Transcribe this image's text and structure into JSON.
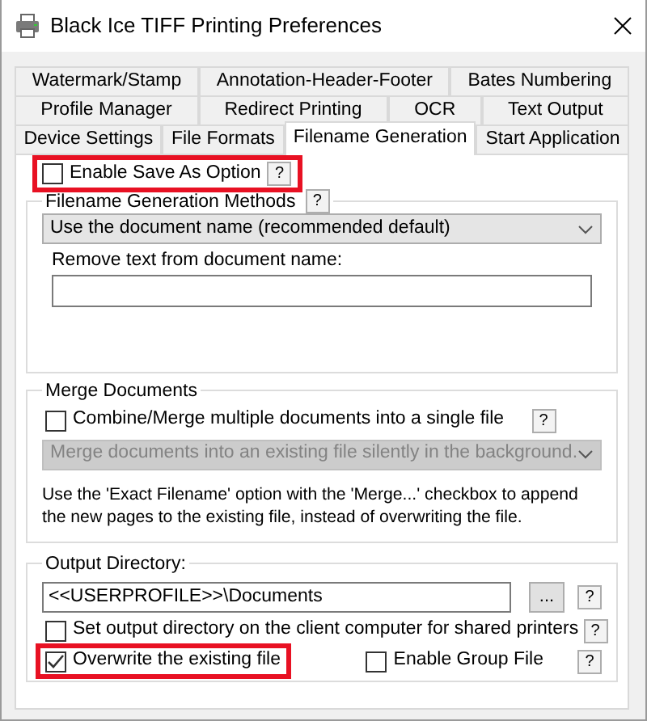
{
  "window": {
    "title": "Black Ice TIFF Printing Preferences"
  },
  "tab_rows": [
    {
      "tabs": [
        {
          "label": "Watermark/Stamp",
          "selected": false
        },
        {
          "label": "Annotation-Header-Footer",
          "selected": false
        },
        {
          "label": "Bates Numbering",
          "selected": false
        }
      ]
    },
    {
      "tabs": [
        {
          "label": "Profile Manager",
          "selected": false
        },
        {
          "label": "Redirect Printing",
          "selected": false
        },
        {
          "label": "OCR",
          "selected": false
        },
        {
          "label": "Text Output",
          "selected": false
        }
      ]
    },
    {
      "tabs": [
        {
          "label": "Device Settings",
          "selected": false
        },
        {
          "label": "File Formats",
          "selected": false
        },
        {
          "label": "Filename Generation",
          "selected": true
        },
        {
          "label": "Start Application",
          "selected": false
        }
      ]
    }
  ],
  "save_as": {
    "label": "Enable Save As Option",
    "checked": false,
    "highlighted": true,
    "help": "?"
  },
  "filename_methods": {
    "legend": "Filename Generation Methods",
    "help": "?",
    "select": {
      "value": "Use the document name (recommended default)"
    },
    "remove_label": "Remove text from document name:"
  },
  "merge": {
    "legend": "Merge Documents",
    "checkbox": {
      "label": "Combine/Merge multiple documents into a single file",
      "checked": false,
      "help": "?"
    },
    "select": {
      "value": "Merge documents into an existing file silently in the background.",
      "disabled": true
    },
    "note": "Use the 'Exact Filename' option with the 'Merge...' checkbox to append the new pages to the existing file, instead of overwriting the file."
  },
  "output": {
    "legend": "Output Directory:",
    "path": "<<USERPROFILE>>\\Documents",
    "browse": "...",
    "help": "?",
    "rows": [
      {
        "checkboxes": [
          {
            "label": "Set output directory on the client computer for shared printers",
            "checked": false
          }
        ],
        "help": "?"
      },
      {
        "checkboxes": [
          {
            "label": "Overwrite the existing file",
            "checked": true,
            "highlighted": true
          },
          {
            "label": "Enable Group File",
            "checked": false
          }
        ],
        "help": "?"
      }
    ]
  }
}
